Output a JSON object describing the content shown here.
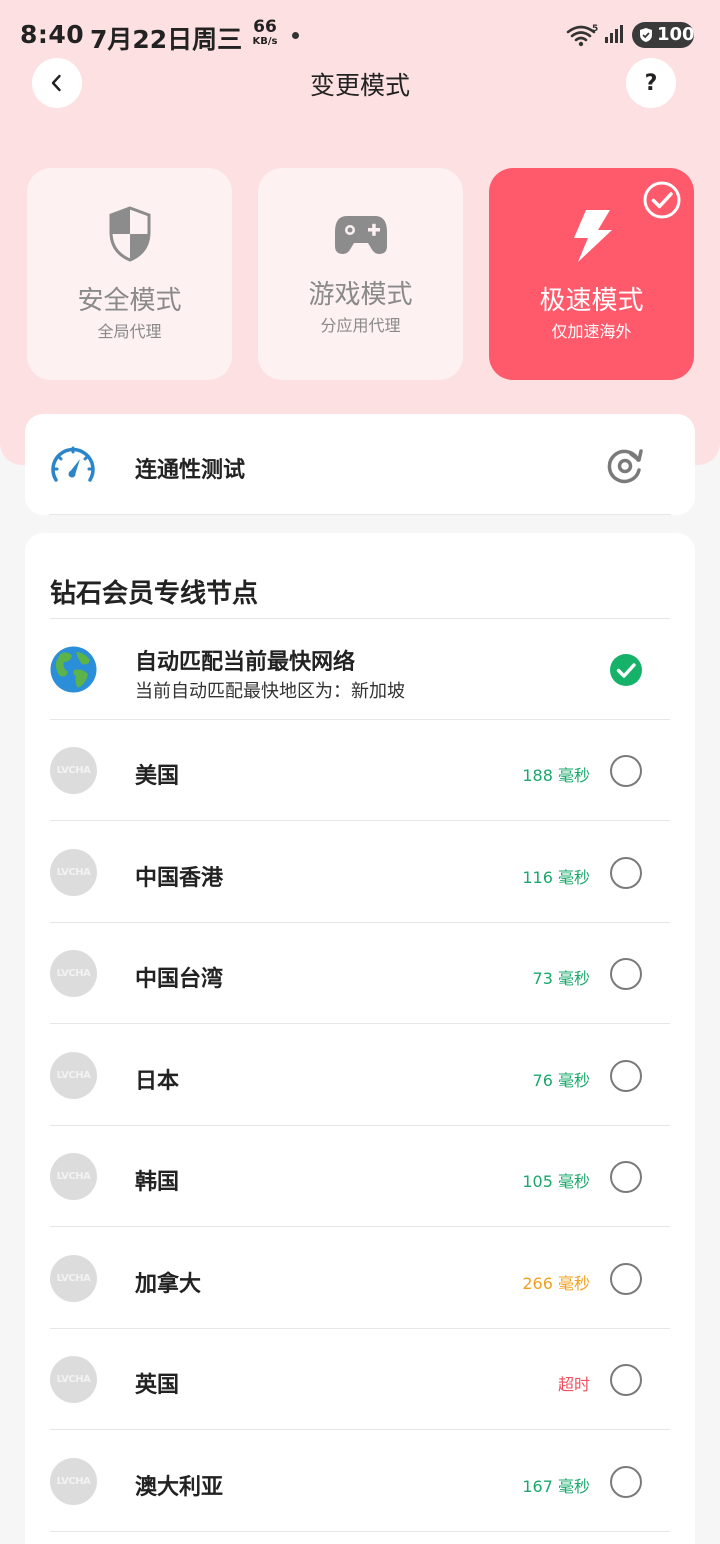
{
  "status_bar": {
    "time": "8:40",
    "date": "7月22日周三",
    "speed_value": "66",
    "speed_unit": "KB/s",
    "battery": "100"
  },
  "header": {
    "title": "变更模式",
    "help_label": "?"
  },
  "modes": [
    {
      "title": "安全模式",
      "subtitle": "全局代理",
      "icon": "shield-icon",
      "active": false
    },
    {
      "title": "游戏模式",
      "subtitle": "分应用代理",
      "icon": "gamepad-icon",
      "active": false
    },
    {
      "title": "极速模式",
      "subtitle": "仅加速海外",
      "icon": "lightning-icon",
      "active": true
    }
  ],
  "connectivity": {
    "label": "连通性测试",
    "icon": "speedometer-icon"
  },
  "nodes_section": {
    "title": "钻石会员专线节点",
    "auto": {
      "name": "自动匹配当前最快网络",
      "description": "当前自动匹配最快地区为：新加坡",
      "selected": true
    },
    "flag_placeholder": "LVCHA",
    "nodes": [
      {
        "name": "美国",
        "latency": "188 毫秒",
        "status": "good"
      },
      {
        "name": "中国香港",
        "latency": "116 毫秒",
        "status": "good"
      },
      {
        "name": "中国台湾",
        "latency": "73 毫秒",
        "status": "good"
      },
      {
        "name": "日本",
        "latency": "76 毫秒",
        "status": "good"
      },
      {
        "name": "韩国",
        "latency": "105 毫秒",
        "status": "good"
      },
      {
        "name": "加拿大",
        "latency": "266 毫秒",
        "status": "slow"
      },
      {
        "name": "英国",
        "latency": "超时",
        "status": "timeout"
      },
      {
        "name": "澳大利亚",
        "latency": "167 毫秒",
        "status": "good"
      }
    ]
  },
  "colors": {
    "accent": "#ff5a6b",
    "header_bg": "#fde0e1",
    "latency_good": "#1aa86b",
    "latency_slow": "#f0a020",
    "latency_timeout": "#f0505f",
    "check_green": "#16b26a"
  }
}
